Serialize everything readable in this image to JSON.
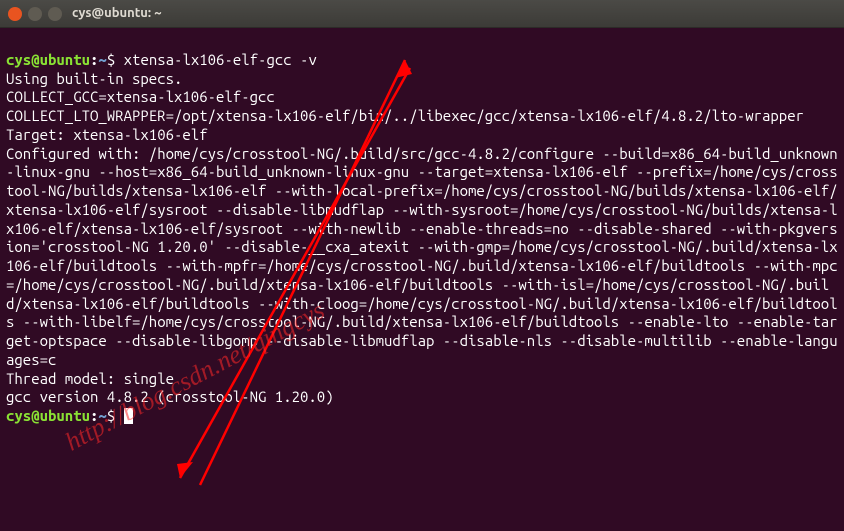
{
  "window": {
    "title": "cys@ubuntu: ~"
  },
  "prompt": {
    "user_host": "cys@ubuntu",
    "colon": ":",
    "path": "~",
    "symbol": "$"
  },
  "command": "xtensa-lx106-elf-gcc -v",
  "output_lines": [
    "Using built-in specs.",
    "COLLECT_GCC=xtensa-lx106-elf-gcc",
    "COLLECT_LTO_WRAPPER=/opt/xtensa-lx106-elf/bin/../libexec/gcc/xtensa-lx106-elf/4.8.2/lto-wrapper",
    "Target: xtensa-lx106-elf",
    "Configured with: /home/cys/crosstool-NG/.build/src/gcc-4.8.2/configure --build=x86_64-build_unknown-linux-gnu --host=x86_64-build_unknown-linux-gnu --target=xtensa-lx106-elf --prefix=/home/cys/crosstool-NG/builds/xtensa-lx106-elf --with-local-prefix=/home/cys/crosstool-NG/builds/xtensa-lx106-elf/xtensa-lx106-elf/sysroot --disable-libmudflap --with-sysroot=/home/cys/crosstool-NG/builds/xtensa-lx106-elf/xtensa-lx106-elf/sysroot --with-newlib --enable-threads=no --disable-shared --with-pkgversion='crosstool-NG 1.20.0' --disable-__cxa_atexit --with-gmp=/home/cys/crosstool-NG/.build/xtensa-lx106-elf/buildtools --with-mpfr=/home/cys/crosstool-NG/.build/xtensa-lx106-elf/buildtools --with-mpc=/home/cys/crosstool-NG/.build/xtensa-lx106-elf/buildtools --with-isl=/home/cys/crosstool-NG/.build/xtensa-lx106-elf/buildtools --with-cloog=/home/cys/crosstool-NG/.build/xtensa-lx106-elf/buildtools --with-libelf=/home/cys/crosstool-NG/.build/xtensa-lx106-elf/buildtools --enable-lto --enable-target-optspace --disable-libgomp --disable-libmudflap --disable-nls --disable-multilib --enable-languages=c",
    "Thread model: single",
    "gcc version 4.8.2 (crosstool-NG 1.20.0)"
  ],
  "watermark": {
    "line1": "http://blog.csdn.net/qingcys"
  }
}
